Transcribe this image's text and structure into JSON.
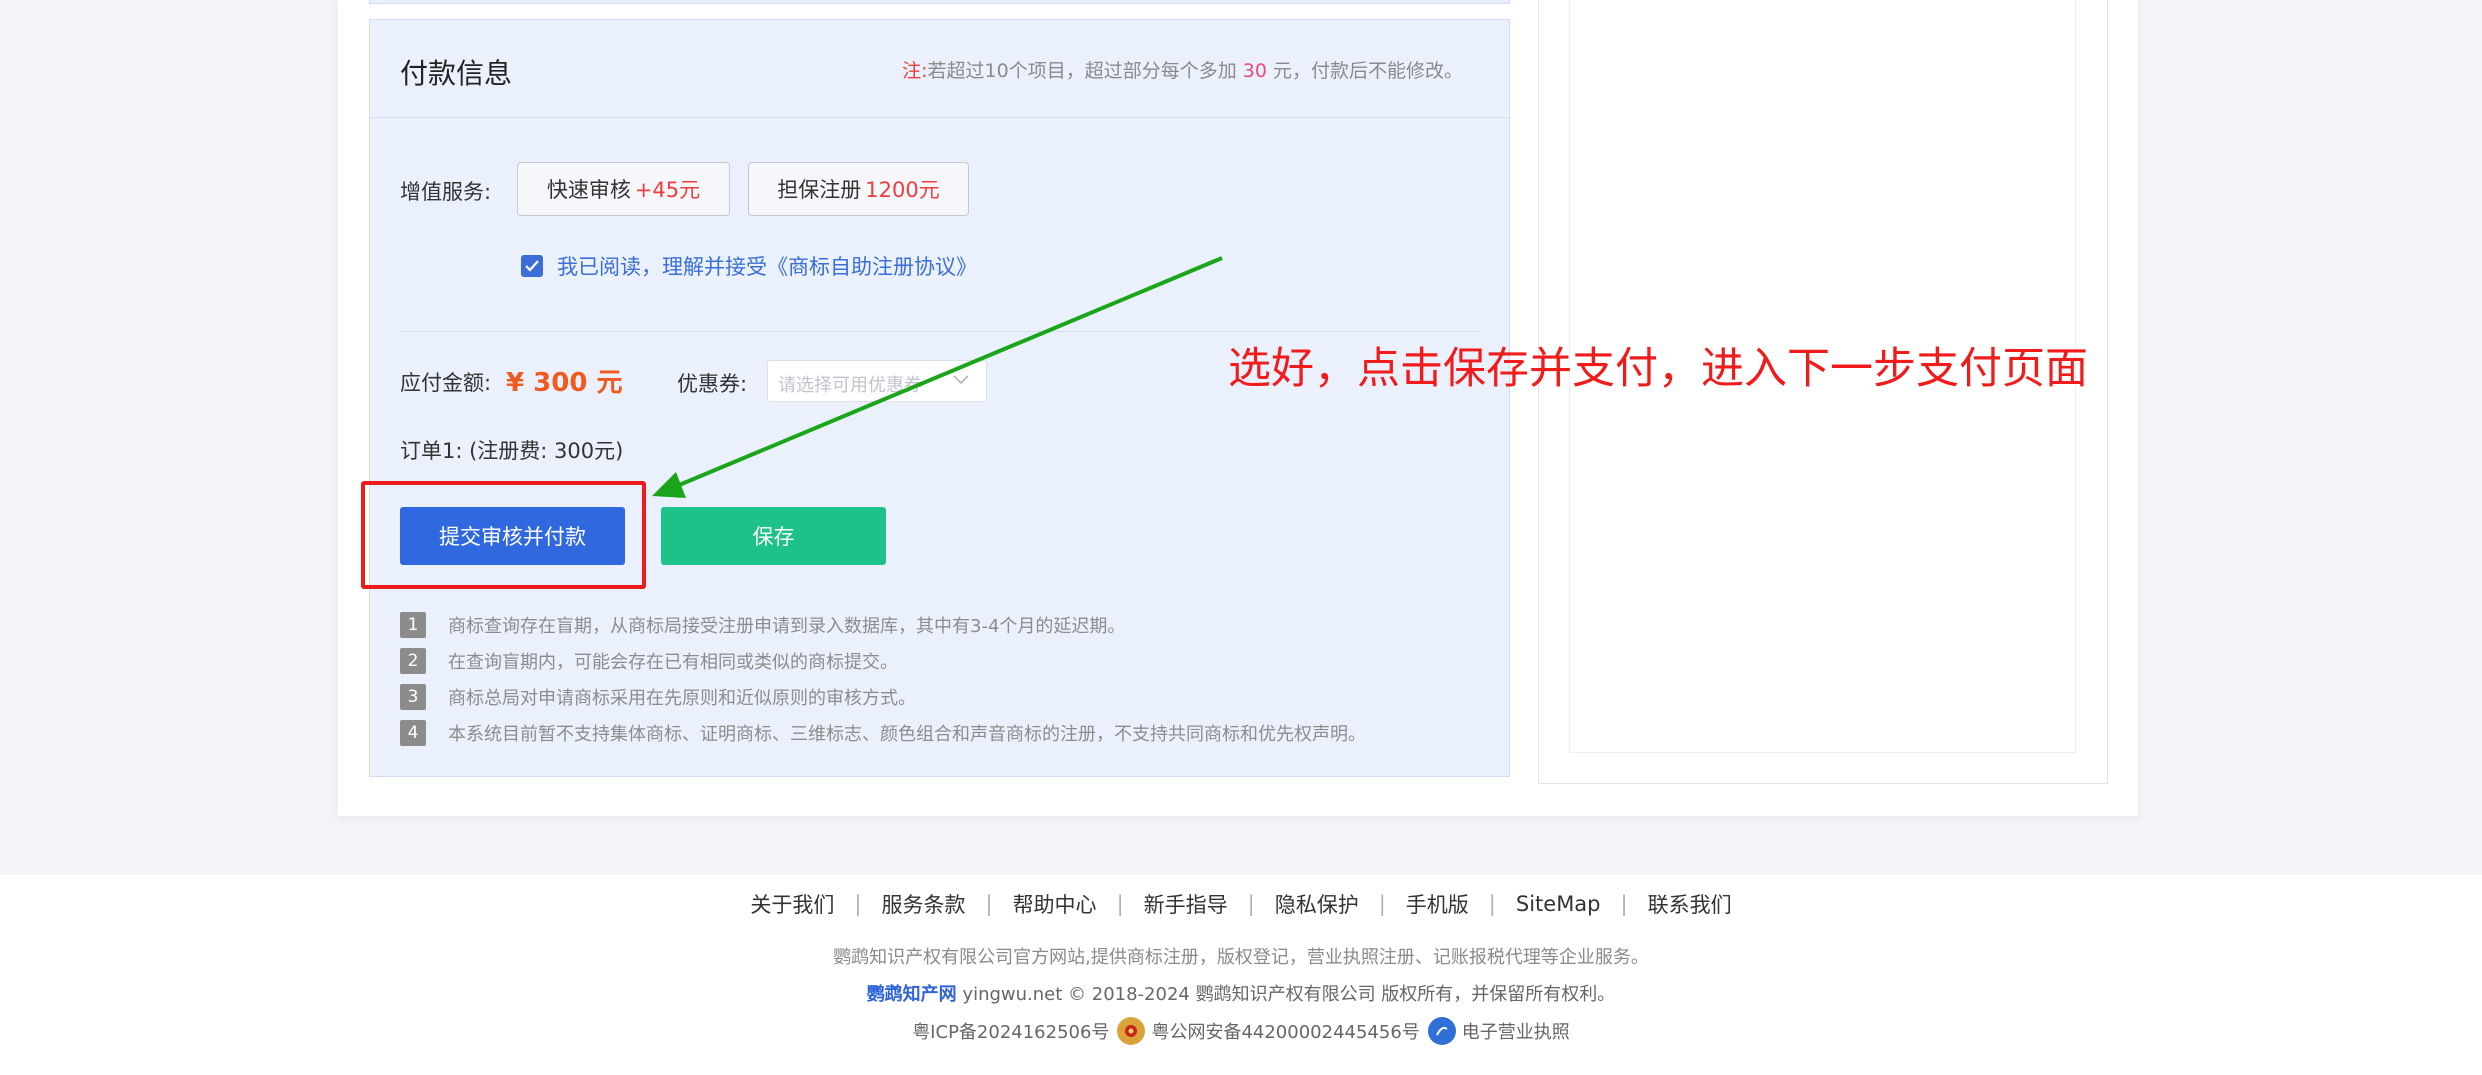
{
  "payment": {
    "title": "付款信息",
    "note_prefix": "注:",
    "note_a": "若超过10个项目，超过部分每个多加",
    "note_amount": "30",
    "note_b": "元，付款后不能修改。"
  },
  "services": {
    "label": "增值服务:",
    "fast_review": {
      "name": "快速审核",
      "price": "+45元"
    },
    "guarantee": {
      "name": "担保注册",
      "price": "1200元"
    }
  },
  "agreement": {
    "checked": true,
    "text": "我已阅读，理解并接受《商标自助注册协议》"
  },
  "amount": {
    "label": "应付金额:",
    "value": "¥ 300 元"
  },
  "coupon": {
    "label": "优惠券:",
    "placeholder": "请选择可用优惠券"
  },
  "order": {
    "line": "订单1:   (注册费: 300元)"
  },
  "buttons": {
    "submit": "提交审核并付款",
    "save": "保存"
  },
  "notes": [
    {
      "num": "1",
      "text": "商标查询存在盲期，从商标局接受注册申请到录入数据库，其中有3-4个月的延迟期。"
    },
    {
      "num": "2",
      "text": "在查询盲期内，可能会存在已有相同或类似的商标提交。"
    },
    {
      "num": "3",
      "text": "商标总局对申请商标采用在先原则和近似原则的审核方式。"
    },
    {
      "num": "4",
      "text": "本系统目前暂不支持集体商标、证明商标、三维标志、颜色组合和声音商标的注册，不支持共同商标和优先权声明。"
    }
  ],
  "annotation": {
    "text": "选好，点击保存并支付，进入下一步支付页面",
    "color": "#f01c1c",
    "arrow_color": "#1aa51a"
  },
  "footer": {
    "links": [
      "关于我们",
      "服务条款",
      "帮助中心",
      "新手指导",
      "隐私保护",
      "手机版",
      "SiteMap",
      "联系我们"
    ],
    "description": "鹦鹉知识产权有限公司官方网站,提供商标注册，版权登记，营业执照注册、记账报税代理等企业服务。",
    "brand": "鹦鹉知产网",
    "copyright": "yingwu.net © 2018-2024 鹦鹉知识产权有限公司 版权所有，并保留所有权利。",
    "icp": "粤ICP备2024162506号",
    "police": "粤公网安备44200002445456号",
    "license": "电子营业执照"
  },
  "colors": {
    "primary": "#3068e0",
    "save": "#1cc287",
    "price": "#f05a1e",
    "accent_red": "#ef3c3c"
  }
}
